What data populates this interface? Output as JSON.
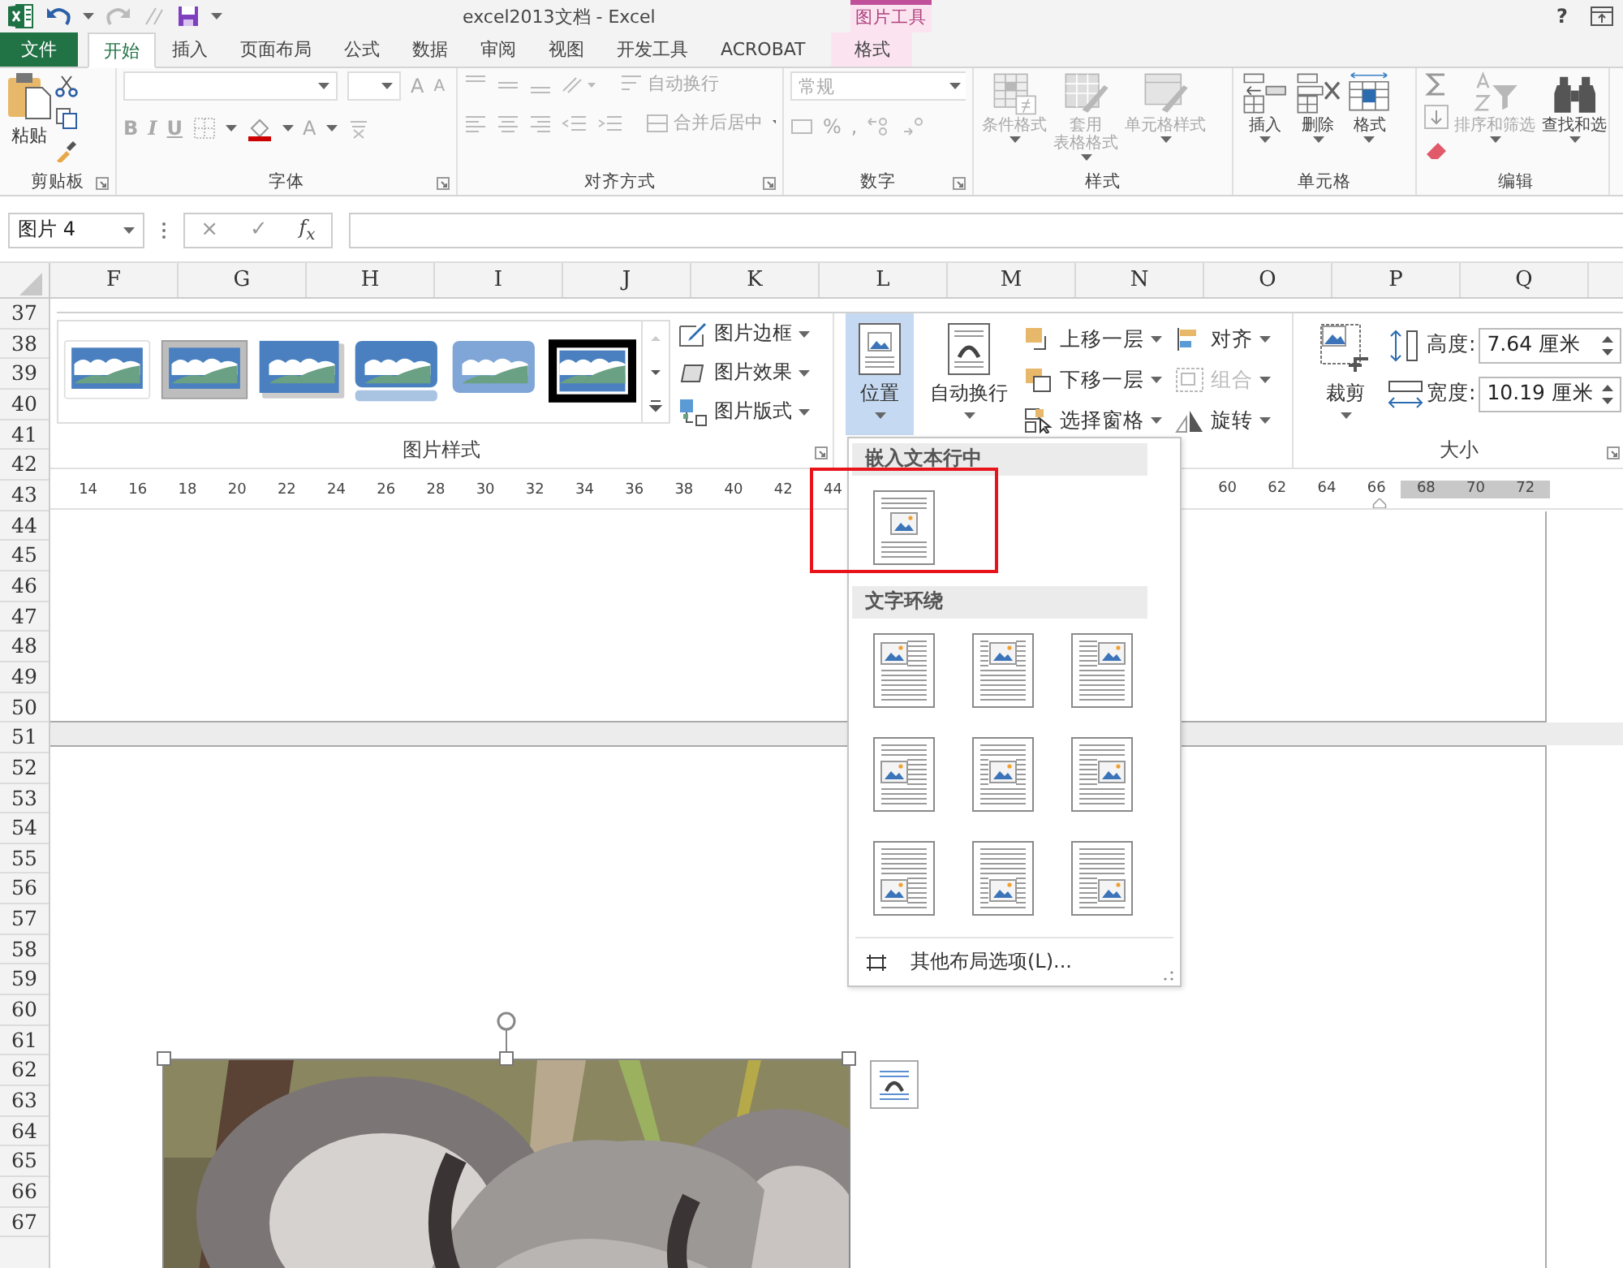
{
  "title_bar": {
    "title": "excel2013文档 - Excel",
    "context_header": "图片工具",
    "help": "?"
  },
  "tabs": [
    {
      "label": "文件",
      "kind": "file",
      "selected": false
    },
    {
      "label": "开始",
      "kind": "normal",
      "selected": true
    },
    {
      "label": "插入",
      "kind": "normal",
      "selected": false
    },
    {
      "label": "页面布局",
      "kind": "normal",
      "selected": false
    },
    {
      "label": "公式",
      "kind": "normal",
      "selected": false
    },
    {
      "label": "数据",
      "kind": "normal",
      "selected": false
    },
    {
      "label": "审阅",
      "kind": "normal",
      "selected": false
    },
    {
      "label": "视图",
      "kind": "normal",
      "selected": false
    },
    {
      "label": "开发工具",
      "kind": "normal",
      "selected": false
    },
    {
      "label": "ACROBAT",
      "kind": "normal",
      "selected": false
    },
    {
      "label": "格式",
      "kind": "context",
      "selected": false
    }
  ],
  "ribbon": {
    "groups": [
      {
        "kind": "clipboard",
        "label": "剪贴板",
        "launcher": true,
        "paste": {
          "label": "粘贴",
          "disabled": false
        }
      },
      {
        "kind": "font",
        "label": "字体",
        "launcher": true,
        "disabled": true,
        "styles": [
          "B",
          "I",
          "U"
        ],
        "size_glyphs": [
          "A",
          "A"
        ],
        "text_color_glyph": "A"
      },
      {
        "kind": "alignment",
        "label": "对齐方式",
        "launcher": true,
        "buttons": [
          {
            "label": "自动换行",
            "disabled": true
          },
          {
            "label": "合并后居中",
            "disabled": true
          }
        ]
      },
      {
        "kind": "number",
        "label": "数字",
        "launcher": true,
        "disabled": true,
        "format": "常规",
        "symbols": [
          "%",
          ","
        ]
      },
      {
        "kind": "large",
        "label": "样式",
        "buttons": [
          {
            "lines": [
              "条件格式"
            ],
            "kind": "conditional",
            "disabled": true
          },
          {
            "lines": [
              "套用",
              "表格格式"
            ],
            "kind": "table",
            "disabled": true
          },
          {
            "lines": [
              "单元格样式"
            ],
            "kind": "cellstyle",
            "disabled": true
          }
        ]
      },
      {
        "kind": "large",
        "label": "单元格",
        "buttons": [
          {
            "lines": [
              "插入"
            ],
            "kind": "insert",
            "disabled": false
          },
          {
            "lines": [
              "删除"
            ],
            "kind": "delete",
            "disabled": false
          },
          {
            "lines": [
              "格式"
            ],
            "kind": "format",
            "disabled": false
          }
        ]
      },
      {
        "kind": "editing",
        "label": "编辑",
        "buttons": [
          {
            "lines": [
              "排序和筛选"
            ],
            "kind": "sort",
            "disabled": true
          },
          {
            "lines": [
              "查找和选"
            ],
            "kind": "find",
            "disabled": false
          }
        ]
      }
    ]
  },
  "formula_bar": {
    "name_box": "图片 4",
    "cancel": "×",
    "enter": "✓",
    "function": "f$_{x}$"
  },
  "columns": [
    "F",
    "G",
    "H",
    "I",
    "J",
    "K",
    "L",
    "M",
    "N",
    "O",
    "P",
    "Q"
  ],
  "rows": [
    "37",
    "38",
    "39",
    "40",
    "41",
    "42",
    "43",
    "44",
    "45",
    "46",
    "47",
    "48",
    "49",
    "50",
    "51",
    "52",
    "53",
    "54",
    "55",
    "56",
    "57",
    "58",
    "59",
    "60",
    "61",
    "62",
    "63",
    "64",
    "65",
    "66",
    "67"
  ],
  "embedded_ribbon": {
    "picture_styles": {
      "label": "图片样式",
      "styles": [
        {
          "kind": "white-frame"
        },
        {
          "kind": "gray-frame"
        },
        {
          "kind": "soft-shadow"
        },
        {
          "kind": "reflection"
        },
        {
          "kind": "soft-edge"
        },
        {
          "kind": "black-frame"
        }
      ],
      "buttons": [
        {
          "label": "图片边框",
          "kind": "border"
        },
        {
          "label": "图片效果",
          "kind": "effect"
        },
        {
          "label": "图片版式",
          "kind": "layout"
        }
      ]
    },
    "arrange": {
      "position": {
        "label": "位置",
        "selected": true
      },
      "wrap": {
        "label": "自动换行"
      },
      "items": [
        {
          "label": "上移一层",
          "kind": "forward",
          "disabled": false
        },
        {
          "label": "下移一层",
          "kind": "backward",
          "disabled": false
        },
        {
          "label": "选择窗格",
          "kind": "pane",
          "disabled": false
        },
        {
          "label": "对齐",
          "kind": "align",
          "disabled": false
        },
        {
          "label": "组合",
          "kind": "group",
          "disabled": true
        },
        {
          "label": "旋转",
          "kind": "rotate",
          "disabled": false
        }
      ]
    },
    "size": {
      "label": "大小",
      "crop": "裁剪",
      "height_label": "高度:",
      "height": "7.64 厘米",
      "width_label": "宽度:",
      "width": "10.19 厘米"
    }
  },
  "ruler": {
    "left_ticks": [
      "14",
      "16",
      "18",
      "20",
      "22",
      "24",
      "26",
      "28",
      "30",
      "32",
      "34",
      "36",
      "38",
      "40",
      "42",
      "44"
    ],
    "right_ticks": [
      "60",
      "62",
      "64",
      "66",
      "68",
      "70",
      "72"
    ]
  },
  "wrap_menu": {
    "sections": [
      {
        "heading": "嵌入文本行中",
        "options": [
          {
            "kind": "inline"
          }
        ]
      },
      {
        "heading": "文字环绕",
        "options": [
          {
            "kind": "top-left"
          },
          {
            "kind": "top-center"
          },
          {
            "kind": "top-right"
          },
          {
            "kind": "middle-left"
          },
          {
            "kind": "middle-center"
          },
          {
            "kind": "middle-right"
          },
          {
            "kind": "bottom-left"
          },
          {
            "kind": "bottom-center"
          },
          {
            "kind": "bottom-right"
          }
        ]
      }
    ],
    "more": "其他布局选项(L)..."
  },
  "annotation": {
    "kind": "red-box"
  },
  "photo": {
    "kind": "picture",
    "selected": true
  }
}
